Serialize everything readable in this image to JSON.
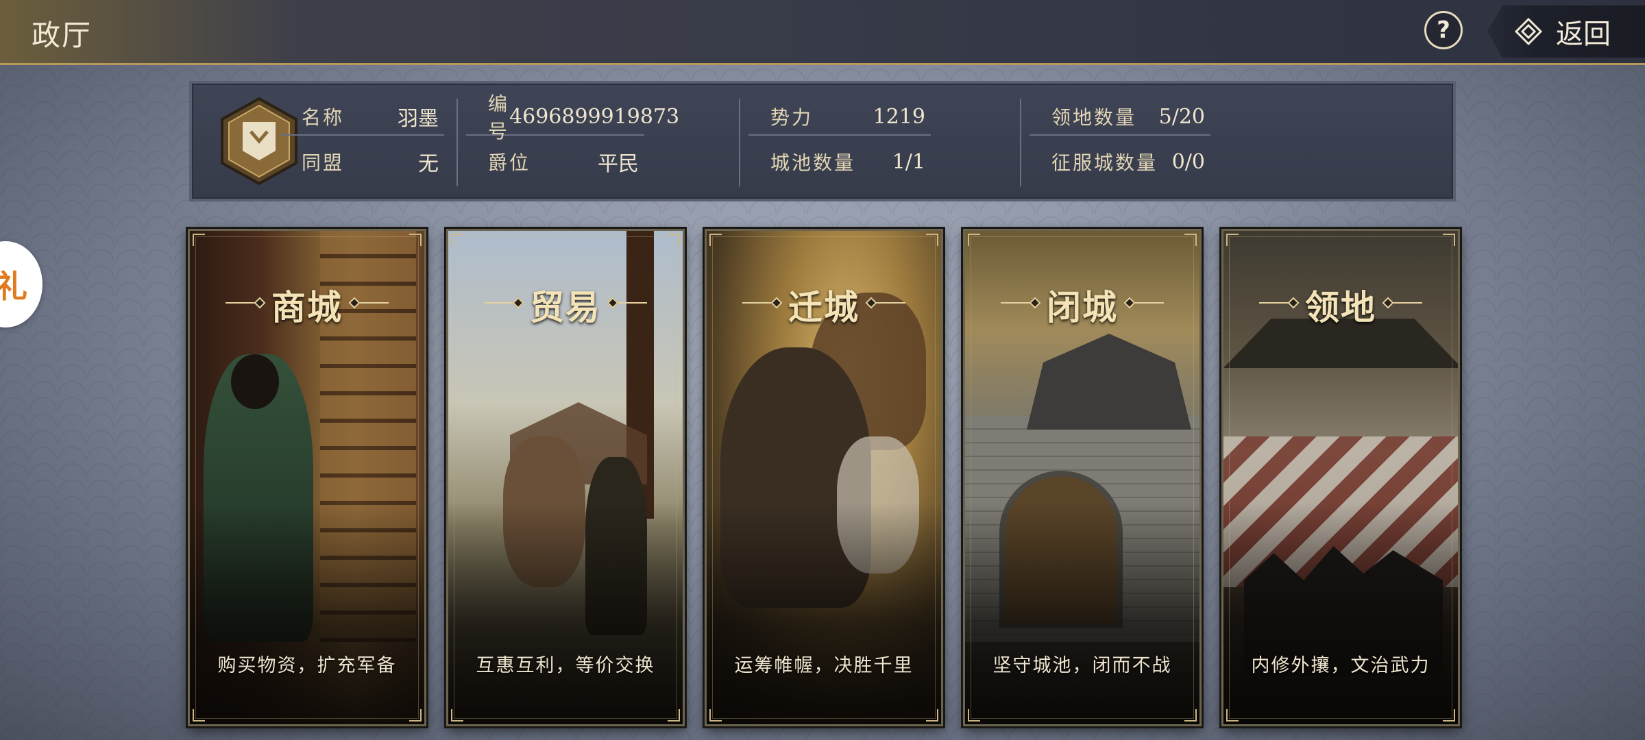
{
  "header": {
    "title": "政厅",
    "help_label": "?",
    "back_label": "返回"
  },
  "side_bubble": {
    "label": "礼"
  },
  "info": {
    "name_label": "名称",
    "name_value": "羽墨",
    "alliance_label": "同盟",
    "alliance_value": "无",
    "id_label": "编号",
    "id_value": "4696899919873",
    "rank_label": "爵位",
    "rank_value": "平民",
    "power_label": "势力",
    "power_value": "1219",
    "city_label": "城池数量",
    "city_value": "1/1",
    "territory_label": "领地数量",
    "territory_value": "5/20",
    "conquered_label": "征服城数量",
    "conquered_value": "0/0"
  },
  "cards": [
    {
      "title": "商城",
      "desc": "购买物资，扩充军备"
    },
    {
      "title": "贸易",
      "desc": "互惠互利，等价交换"
    },
    {
      "title": "迁城",
      "desc": "运筹帷幄，决胜千里"
    },
    {
      "title": "闭城",
      "desc": "坚守城池，闭而不战"
    },
    {
      "title": "领地",
      "desc": "内修外攘，文治武力"
    }
  ],
  "colors": {
    "gold": "#e6d2a0",
    "panel": "#3f4556",
    "topbar": "#353947"
  }
}
